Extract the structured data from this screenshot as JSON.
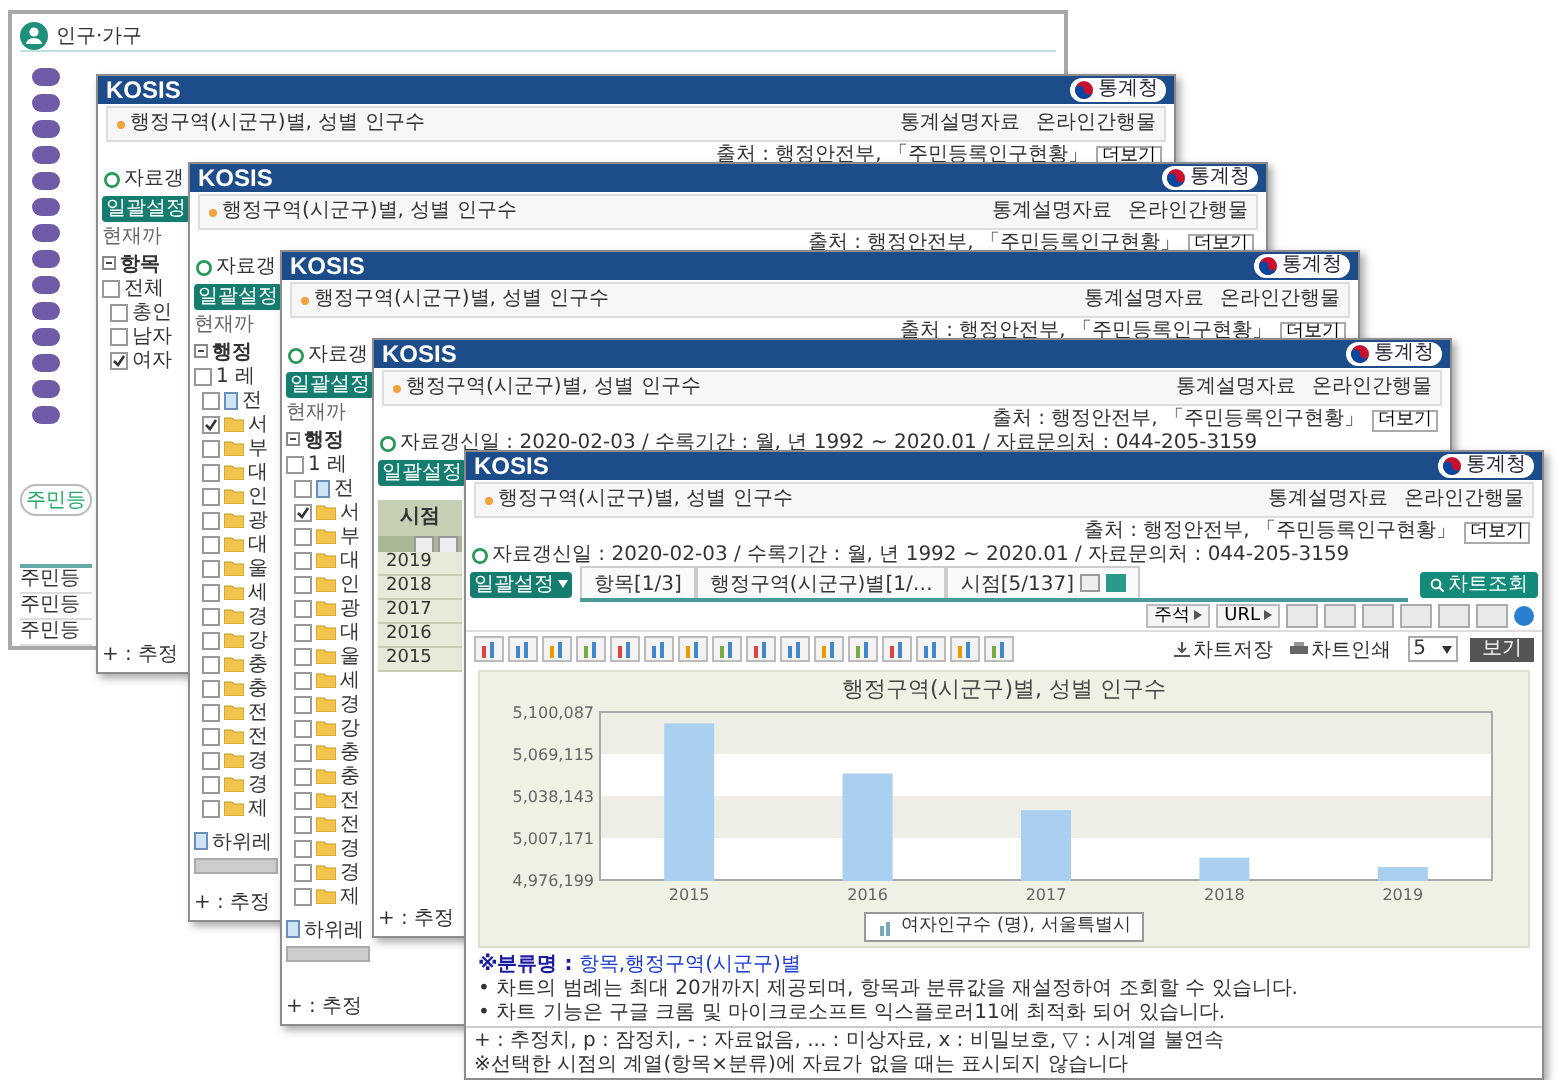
{
  "background_window": {
    "title": "인구·가구",
    "button": "주민등",
    "table_rows": [
      "주민등",
      "주민등",
      "주민등"
    ]
  },
  "windows": [
    {
      "kind": "back",
      "logo": "KOSIS",
      "agency": "통계청",
      "title": "행정구역(시군구)별, 성별 인구수",
      "links": [
        "통계설명자료",
        "온라인간행물"
      ],
      "source": "출처 : 행정안전부, 「주민등록인구현황」",
      "more_button": "더보기",
      "info": "자료갱",
      "settings_button": "일괄설정",
      "panel": {
        "kind": "tree",
        "note": "현재까",
        "heading": "항목",
        "items": [
          {
            "kind": "check",
            "label": "전체",
            "checked": false
          },
          {
            "kind": "check",
            "label": "총인",
            "checked": false
          },
          {
            "kind": "check",
            "label": "남자",
            "checked": false
          },
          {
            "kind": "check",
            "label": "여자",
            "checked": true
          }
        ]
      },
      "footer": "+ : 추정"
    },
    {
      "kind": "back",
      "logo": "KOSIS",
      "agency": "통계청",
      "title": "행정구역(시군구)별, 성별 인구수",
      "links": [
        "통계설명자료",
        "온라인간행물"
      ],
      "source": "출처 : 행정안전부, 「주민등록인구현황」",
      "more_button": "더보기",
      "info": "자료갱",
      "settings_button": "일괄설정",
      "panel": {
        "kind": "tree",
        "note": "현재까",
        "heading": "행정",
        "items": [
          {
            "kind": "check",
            "label": "1 레",
            "checked": false
          },
          {
            "kind": "doc",
            "label": "전",
            "checked": false
          },
          {
            "kind": "folder",
            "label": "서",
            "checked": true
          },
          {
            "kind": "folder",
            "label": "부",
            "checked": false
          },
          {
            "kind": "folder",
            "label": "대",
            "checked": false
          },
          {
            "kind": "folder",
            "label": "인",
            "checked": false
          },
          {
            "kind": "folder",
            "label": "광",
            "checked": false
          },
          {
            "kind": "folder",
            "label": "대",
            "checked": false
          },
          {
            "kind": "folder",
            "label": "울",
            "checked": false
          },
          {
            "kind": "folder",
            "label": "세",
            "checked": false
          },
          {
            "kind": "folder",
            "label": "경",
            "checked": false
          },
          {
            "kind": "folder",
            "label": "강",
            "checked": false
          },
          {
            "kind": "folder",
            "label": "충",
            "checked": false
          },
          {
            "kind": "folder",
            "label": "충",
            "checked": false
          },
          {
            "kind": "folder",
            "label": "전",
            "checked": false
          },
          {
            "kind": "folder",
            "label": "전",
            "checked": false
          },
          {
            "kind": "folder",
            "label": "경",
            "checked": false
          },
          {
            "kind": "folder",
            "label": "경",
            "checked": false
          },
          {
            "kind": "folder",
            "label": "제",
            "checked": false
          }
        ],
        "sublevel": "하위레"
      },
      "footer": "+ : 추정"
    },
    {
      "kind": "back",
      "logo": "KOSIS",
      "agency": "통계청",
      "title": "행정구역(시군구)별, 성별 인구수",
      "links": [
        "통계설명자료",
        "온라인간행물"
      ],
      "source": "출처 : 행정안전부, 「주민등록인구현황」",
      "more_button": "더보기",
      "info": "자료갱",
      "settings_button": "일괄설정",
      "panel": {
        "kind": "tree",
        "note": "현재까",
        "heading": "행정",
        "items": [
          {
            "kind": "check",
            "label": "1 레",
            "checked": false
          },
          {
            "kind": "doc",
            "label": "전",
            "checked": false
          },
          {
            "kind": "folder",
            "label": "서",
            "checked": true
          },
          {
            "kind": "folder",
            "label": "부",
            "checked": false
          },
          {
            "kind": "folder",
            "label": "대",
            "checked": false
          },
          {
            "kind": "folder",
            "label": "인",
            "checked": false
          },
          {
            "kind": "folder",
            "label": "광",
            "checked": false
          },
          {
            "kind": "folder",
            "label": "대",
            "checked": false
          },
          {
            "kind": "folder",
            "label": "울",
            "checked": false
          },
          {
            "kind": "folder",
            "label": "세",
            "checked": false
          },
          {
            "kind": "folder",
            "label": "경",
            "checked": false
          },
          {
            "kind": "folder",
            "label": "강",
            "checked": false
          },
          {
            "kind": "folder",
            "label": "충",
            "checked": false
          },
          {
            "kind": "folder",
            "label": "충",
            "checked": false
          },
          {
            "kind": "folder",
            "label": "전",
            "checked": false
          },
          {
            "kind": "folder",
            "label": "전",
            "checked": false
          },
          {
            "kind": "folder",
            "label": "경",
            "checked": false
          },
          {
            "kind": "folder",
            "label": "경",
            "checked": false
          },
          {
            "kind": "folder",
            "label": "제",
            "checked": false
          }
        ],
        "sublevel": "하위레"
      },
      "footer": "+ : 추정"
    },
    {
      "kind": "back",
      "logo": "KOSIS",
      "agency": "통계청",
      "title": "행정구역(시군구)별, 성별 인구수",
      "links": [
        "통계설명자료",
        "온라인간행물"
      ],
      "source": "출처 : 행정안전부, 「주민등록인구현황」",
      "more_button": "더보기",
      "info": "자료갱신일 : 2020-02-03 / 수록기간 : 월, 년 1992 ~ 2020.01 / 자료문의처 : 044-205-3159",
      "settings_button": "일괄설정",
      "panel": {
        "kind": "table",
        "heading": "시점",
        "rows": [
          "2019",
          "2018",
          "2017",
          "2016",
          "2015"
        ]
      },
      "footer": "+ : 추정"
    },
    {
      "kind": "front",
      "logo": "KOSIS",
      "agency": "통계청",
      "title": "행정구역(시군구)별, 성별 인구수",
      "links": [
        "통계설명자료",
        "온라인간행물"
      ],
      "source": "출처 : 행정안전부, 「주민등록인구현황」",
      "more_button": "더보기",
      "info": "자료갱신일 : 2020-02-03 / 수록기간 : 월, 년 1992 ~ 2020.01 / 자료문의처 : 044-205-3159",
      "settings_button": "일괄설정",
      "tabs": [
        "항목[1/3]",
        "행정구역(시군구)별[1/…",
        "시점[5/137]"
      ],
      "search_button": "차트조회",
      "annotation_button": "주석",
      "url_button": "URL",
      "save_button": "차트저장",
      "print_button": "차트인쇄",
      "count_select": "5",
      "view_button": "보기",
      "chart_title": "행정구역(시군구)별, 성별 인구수",
      "chart_data": {
        "type": "bar",
        "categories": [
          "2015",
          "2016",
          "2017",
          "2018",
          "2019"
        ],
        "series": [
          {
            "name": "여자인구수 (명), 서울특별시",
            "color": "#a9d0f0",
            "values": [
              5091000,
              5054000,
              5027000,
              4992000,
              4985000
            ]
          }
        ],
        "ylim": [
          4976199,
          5100087
        ],
        "yticks": [
          {
            "value": 4976199,
            "label": "4,976,199"
          },
          {
            "value": 5007171,
            "label": "5,007,171"
          },
          {
            "value": 5038143,
            "label": "5,038,143"
          },
          {
            "value": 5069115,
            "label": "5,069,115"
          },
          {
            "value": 5100087,
            "label": "5,100,087"
          }
        ]
      },
      "classification_label": "※분류명 :",
      "classification_link": "항목,행정구역(시군구)별",
      "notes": [
        "• 차트의 범례는 최대 20개까지 제공되며, 항목과 분류값을 재설정하여 조회할 수 있습니다.",
        "• 차트 기능은 구글 크롬 및 마이크로소프트 익스플로러11에 최적화 되어 있습니다."
      ],
      "footer": "+ : 추정치, p : 잠정치, - : 자료없음, ... : 미상자료, x : 비밀보호, ▽ : 시계열 불연속",
      "footer_note": "※선택한 시점의 계열(항목×분류)에 자료가 없을 때는 표시되지 않습니다"
    }
  ]
}
